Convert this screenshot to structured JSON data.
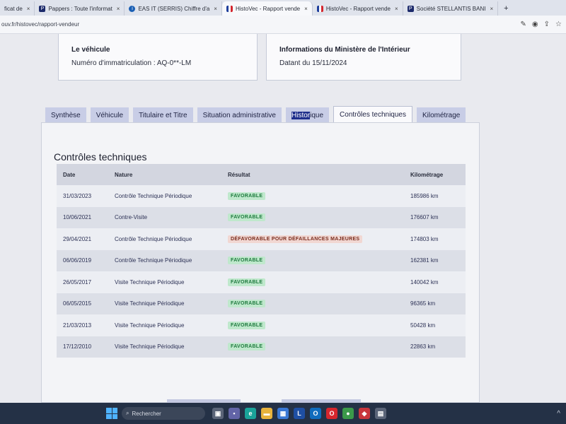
{
  "browser": {
    "tabs": [
      {
        "label": "ficat de",
        "favicon": ""
      },
      {
        "label": "Pappers : Toute l'informat",
        "favicon": "P"
      },
      {
        "label": "EAS IT (SERRIS) Chiffre d'a",
        "favicon": "i"
      },
      {
        "label": "HistoVec - Rapport vende",
        "favicon": "flag",
        "active": true
      },
      {
        "label": "HistoVec - Rapport vende",
        "favicon": "flag"
      },
      {
        "label": "Société STELLANTIS BANI",
        "favicon": "P"
      }
    ],
    "new_tab": "+",
    "close": "×",
    "url": "ouv.fr/histovec/rapport-vendeur"
  },
  "vehicle_card": {
    "title": "Le véhicule",
    "text": "Numéro d'immatriculation : AQ-0**-LM"
  },
  "ministry_card": {
    "title": "Informations du Ministère de l'Intérieur",
    "text": "Datant du 15/11/2024"
  },
  "page_tabs": {
    "synthese": "Synthèse",
    "vehicule": "Véhicule",
    "titulaire": "Titulaire et Titre",
    "situation": "Situation administrative",
    "historique_highlight": "Histor",
    "historique_rest": "ique",
    "controles": "Contrôles techniques",
    "kilometrage": "Kilométrage"
  },
  "section_title": "Contrôles techniques",
  "table": {
    "headers": [
      "Date",
      "Nature",
      "Résultat",
      "Kilométrage"
    ],
    "rows": [
      {
        "date": "31/03/2023",
        "nature": "Contrôle Technique Périodique",
        "result": "FAVORABLE",
        "km": "185986 km"
      },
      {
        "date": "10/06/2021",
        "nature": "Contre-Visite",
        "result": "FAVORABLE",
        "km": "176607 km"
      },
      {
        "date": "29/04/2021",
        "nature": "Contrôle Technique Périodique",
        "result": "DÉFAVORABLE POUR DÉFAILLANCES MAJEURES",
        "km": "174803 km"
      },
      {
        "date": "06/06/2019",
        "nature": "Contrôle Technique Périodique",
        "result": "FAVORABLE",
        "km": "162381 km"
      },
      {
        "date": "26/05/2017",
        "nature": "Visite Technique Périodique",
        "result": "FAVORABLE",
        "km": "140042 km"
      },
      {
        "date": "06/05/2015",
        "nature": "Visite Technique Périodique",
        "result": "FAVORABLE",
        "km": "96365 km"
      },
      {
        "date": "21/03/2013",
        "nature": "Visite Technique Périodique",
        "result": "FAVORABLE",
        "km": "50428 km"
      },
      {
        "date": "17/12/2010",
        "nature": "Visite Technique Périodique",
        "result": "FAVORABLE",
        "km": "22863 km"
      }
    ]
  },
  "taskbar": {
    "search_placeholder": "Rechercher"
  },
  "colors": {
    "favorable_bg": "#bfe8cc",
    "defavorable_bg": "#f1d7d2",
    "tab_bg": "#c8cde6"
  }
}
